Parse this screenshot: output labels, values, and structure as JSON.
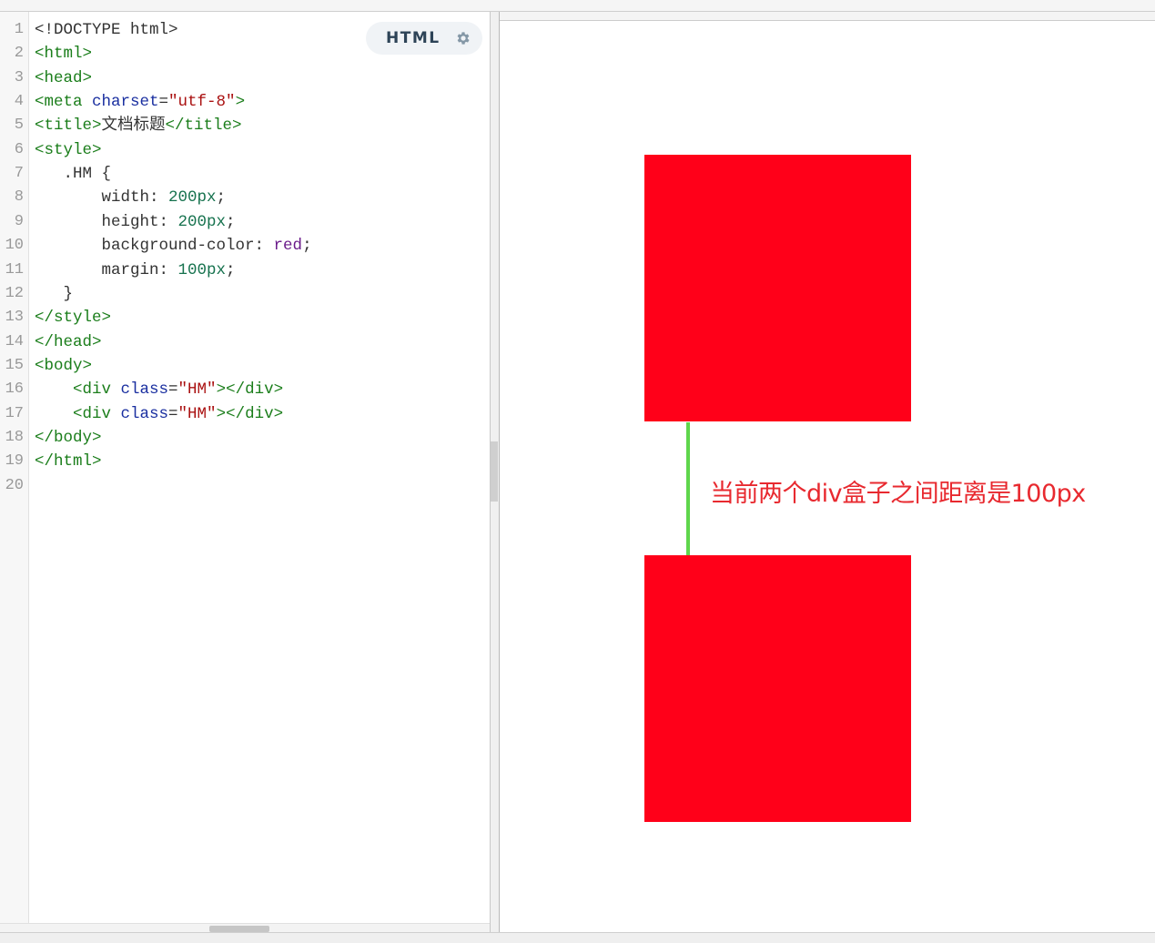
{
  "editor": {
    "language_label": "HTML",
    "lines": [
      {
        "num": "1",
        "tokens": [
          {
            "t": "plain",
            "v": "<!DOCTYPE html>"
          }
        ]
      },
      {
        "num": "2",
        "tokens": [
          {
            "t": "tag",
            "v": "<html>"
          }
        ]
      },
      {
        "num": "3",
        "tokens": [
          {
            "t": "tag",
            "v": "<head>"
          }
        ]
      },
      {
        "num": "4",
        "tokens": [
          {
            "t": "tag",
            "v": "<meta "
          },
          {
            "t": "attr",
            "v": "charset"
          },
          {
            "t": "plain",
            "v": "="
          },
          {
            "t": "str",
            "v": "\"utf-8\""
          },
          {
            "t": "tag",
            "v": ">"
          }
        ]
      },
      {
        "num": "5",
        "tokens": [
          {
            "t": "tag",
            "v": "<title>"
          },
          {
            "t": "plain",
            "v": "文档标题"
          },
          {
            "t": "tag",
            "v": "</title>"
          }
        ]
      },
      {
        "num": "6",
        "tokens": [
          {
            "t": "tag",
            "v": "<style>"
          }
        ]
      },
      {
        "num": "7",
        "tokens": [
          {
            "t": "plain",
            "v": "   .HM {"
          }
        ]
      },
      {
        "num": "8",
        "tokens": [
          {
            "t": "prop",
            "v": "       width: "
          },
          {
            "t": "num",
            "v": "200px"
          },
          {
            "t": "plain",
            "v": ";"
          }
        ]
      },
      {
        "num": "9",
        "tokens": [
          {
            "t": "prop",
            "v": "       height: "
          },
          {
            "t": "num",
            "v": "200px"
          },
          {
            "t": "plain",
            "v": ";"
          }
        ]
      },
      {
        "num": "10",
        "tokens": [
          {
            "t": "prop",
            "v": "       background-color: "
          },
          {
            "t": "kw",
            "v": "red"
          },
          {
            "t": "plain",
            "v": ";"
          }
        ]
      },
      {
        "num": "11",
        "tokens": [
          {
            "t": "prop",
            "v": "       margin: "
          },
          {
            "t": "num",
            "v": "100px"
          },
          {
            "t": "plain",
            "v": ";"
          }
        ]
      },
      {
        "num": "12",
        "tokens": [
          {
            "t": "plain",
            "v": "   }"
          }
        ]
      },
      {
        "num": "13",
        "tokens": [
          {
            "t": "tag",
            "v": "</style>"
          }
        ]
      },
      {
        "num": "14",
        "tokens": [
          {
            "t": "tag",
            "v": "</head>"
          }
        ]
      },
      {
        "num": "15",
        "tokens": [
          {
            "t": "tag",
            "v": "<body>"
          }
        ]
      },
      {
        "num": "16",
        "tokens": [
          {
            "t": "tag",
            "v": "    <div "
          },
          {
            "t": "attr",
            "v": "class"
          },
          {
            "t": "plain",
            "v": "="
          },
          {
            "t": "str",
            "v": "\"HM\""
          },
          {
            "t": "tag",
            "v": "></div>"
          }
        ]
      },
      {
        "num": "17",
        "tokens": [
          {
            "t": "tag",
            "v": "    <div "
          },
          {
            "t": "attr",
            "v": "class"
          },
          {
            "t": "plain",
            "v": "="
          },
          {
            "t": "str",
            "v": "\"HM\""
          },
          {
            "t": "tag",
            "v": "></div>"
          }
        ]
      },
      {
        "num": "18",
        "tokens": [
          {
            "t": "tag",
            "v": "</body>"
          }
        ]
      },
      {
        "num": "19",
        "tokens": [
          {
            "t": "tag",
            "v": "</html>"
          }
        ]
      },
      {
        "num": "20",
        "tokens": []
      }
    ]
  },
  "preview": {
    "annotation": "当前两个div盒子之间距离是100px",
    "box_color": "#ff0019",
    "marker_color": "#5fd64b",
    "annotation_color": "#e8292f"
  },
  "icons": {
    "settings": "gear-icon"
  }
}
